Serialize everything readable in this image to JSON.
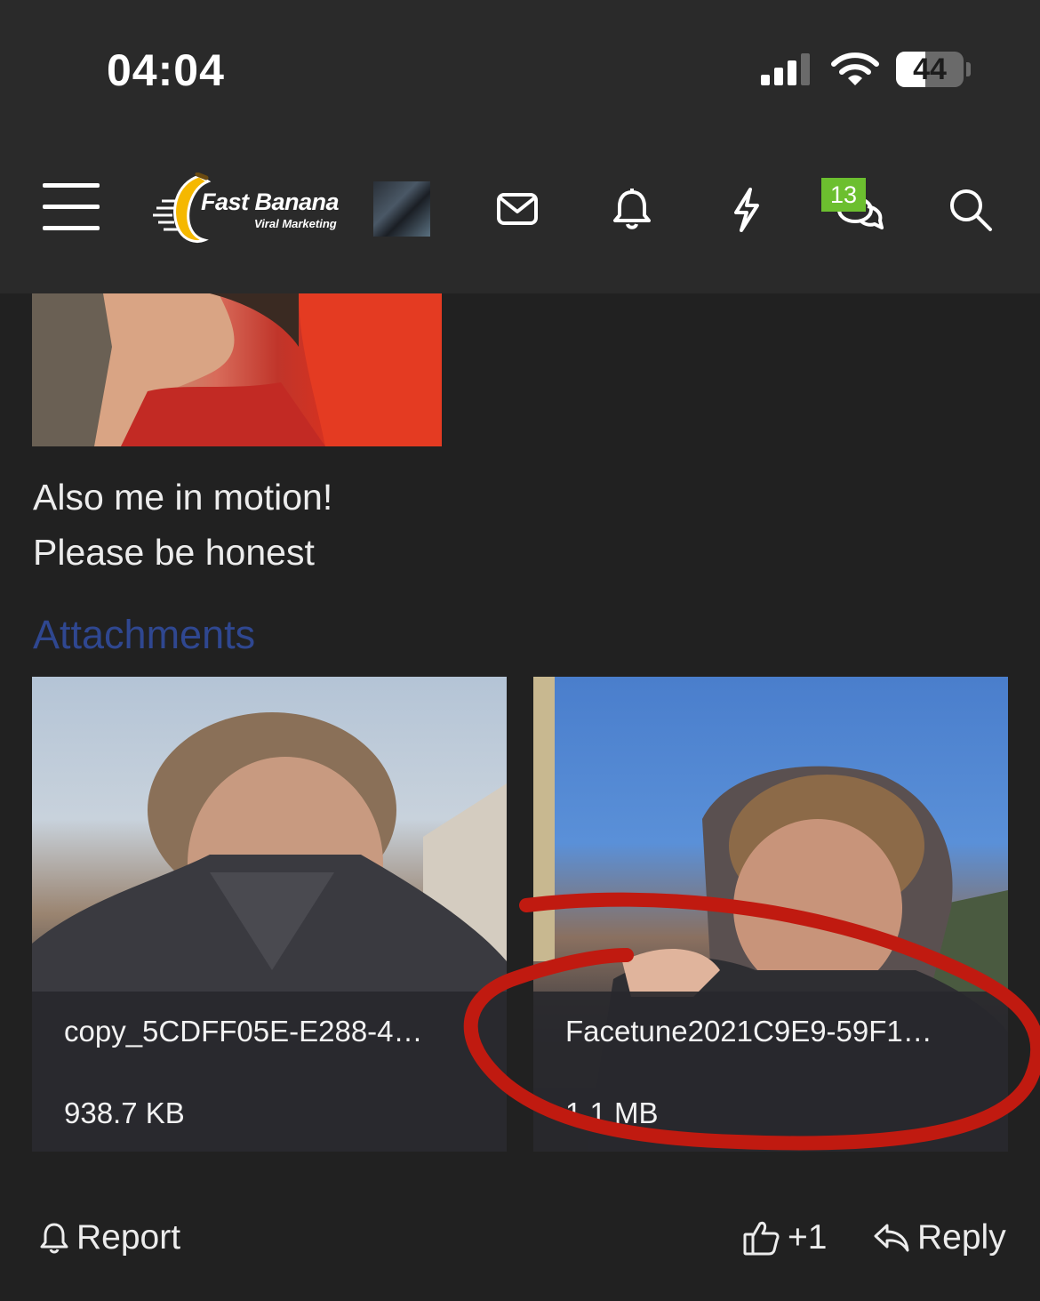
{
  "status_bar": {
    "time": "04:04",
    "battery_level": "44",
    "battery_fraction": 0.44,
    "icons": [
      "signal-icon",
      "wifi-icon",
      "battery-icon"
    ]
  },
  "navbar": {
    "logo_title": "Fast Banana",
    "logo_subtitle": "Viral Marketing",
    "conversations_badge": "13",
    "icons": [
      "menu-icon",
      "avatar",
      "mail-icon",
      "bell-icon",
      "lightning-icon",
      "chat-icon",
      "search-icon"
    ]
  },
  "post": {
    "text_line_1": "Also me in motion!",
    "text_line_2": "Please be honest"
  },
  "attachments": {
    "title": "Attachments",
    "items": [
      {
        "name": "copy_5CDFF05E-E288-4…",
        "size": "938.7 KB"
      },
      {
        "name": "Facetune2021C9E9-59F1…",
        "size": "1.1 MB"
      }
    ]
  },
  "actions": {
    "report_label": "Report",
    "like_label": "+1",
    "reply_label": "Reply"
  },
  "colors": {
    "background": "#212121",
    "header": "#2a2a2a",
    "link": "#2f4790",
    "badge": "#6cbf2f",
    "annotation": "#c01a10",
    "logo_banana": "#f5b800"
  }
}
